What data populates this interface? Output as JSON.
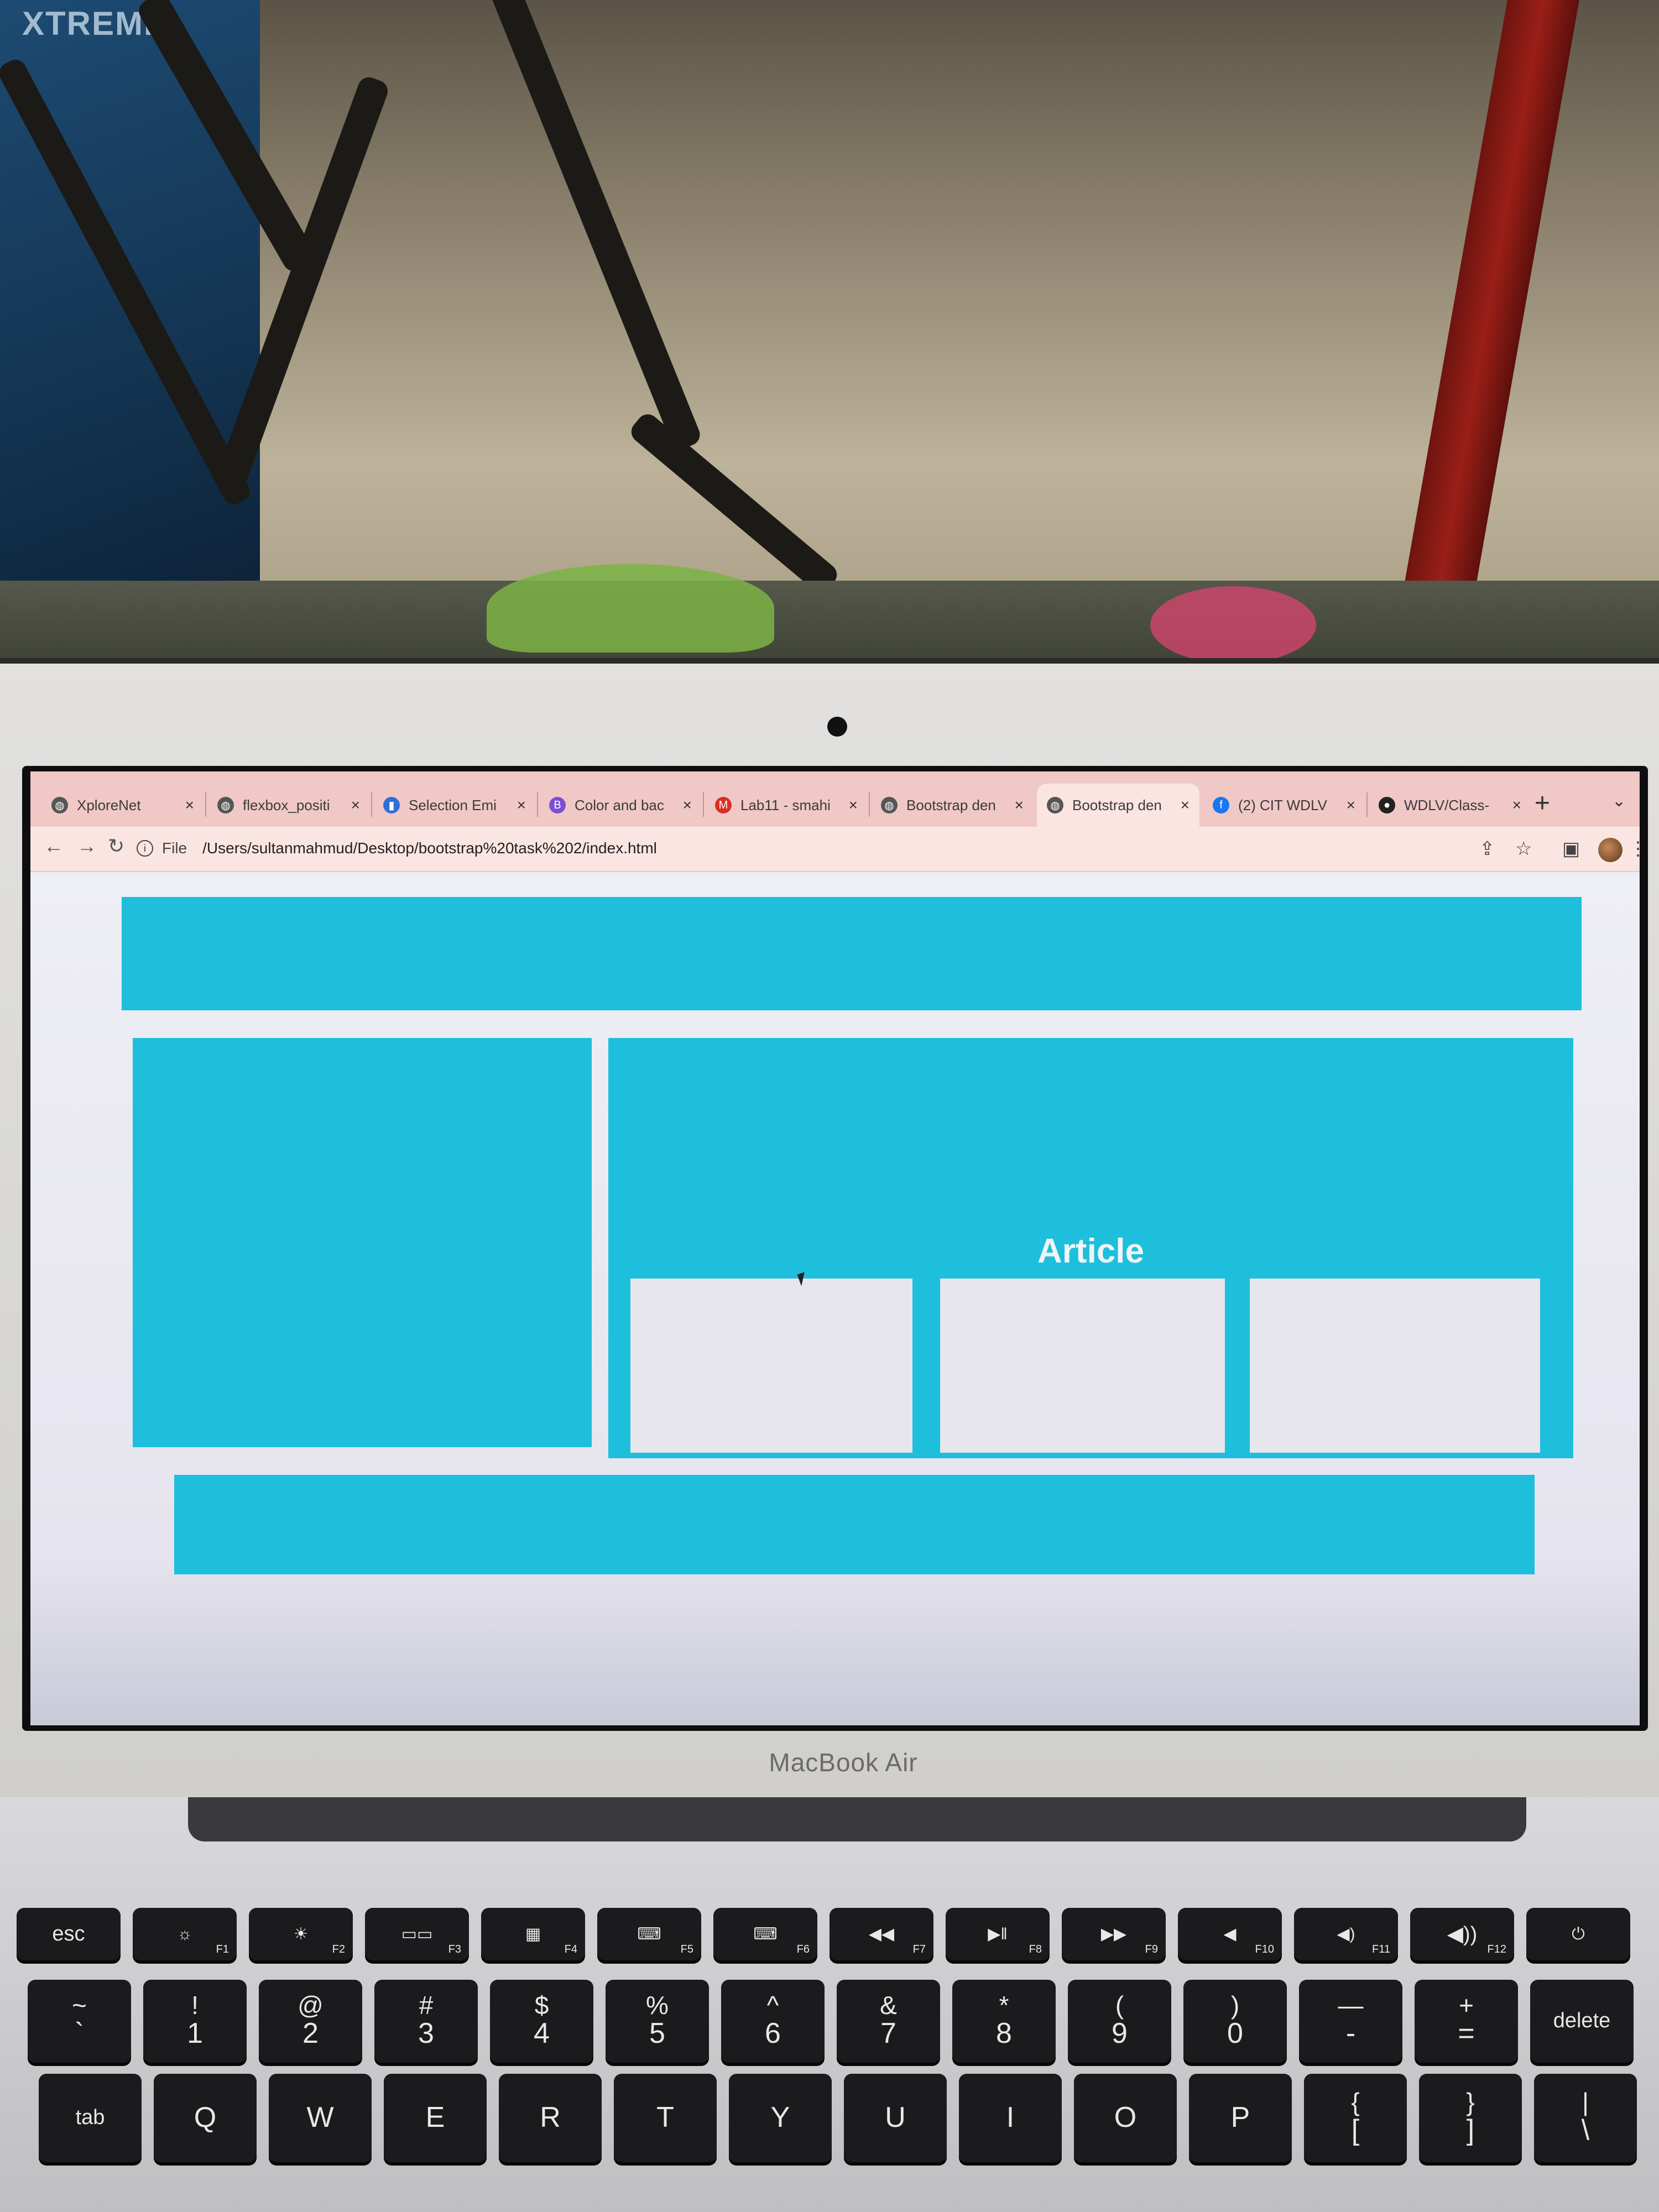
{
  "photo": {
    "poster_text": "XTREME",
    "laptop_label": "MacBook Air"
  },
  "browser": {
    "tabs": [
      {
        "title": "XploreNet",
        "icon": "globe-icon",
        "glyph": "◍",
        "icon_color": "#555555"
      },
      {
        "title": "flexbox_positi",
        "icon": "globe-icon",
        "glyph": "◍",
        "icon_color": "#555555"
      },
      {
        "title": "Selection Emi",
        "icon": "selection-emi-icon",
        "glyph": "▮",
        "icon_color": "#2f6fd6"
      },
      {
        "title": "Color and bac",
        "icon": "bootstrap-icon",
        "glyph": "B",
        "icon_color": "#7b4fd6"
      },
      {
        "title": "Lab11 - smahi",
        "icon": "gmail-icon",
        "glyph": "M",
        "icon_color": "#d93025"
      },
      {
        "title": "Bootstrap den",
        "icon": "globe-icon",
        "glyph": "◍",
        "icon_color": "#555555"
      },
      {
        "title": "Bootstrap den",
        "icon": "globe-icon",
        "glyph": "◍",
        "icon_color": "#555555",
        "active": true
      },
      {
        "title": "(2) CIT WDLV",
        "icon": "facebook-icon",
        "glyph": "f",
        "icon_color": "#1877f2"
      },
      {
        "title": "WDLV/Class-",
        "icon": "github-icon",
        "glyph": "●",
        "icon_color": "#222222"
      }
    ],
    "close_glyph": "×",
    "new_tab_glyph": "+",
    "tab_menu_glyph": "⌄",
    "address": {
      "scheme": "File",
      "url": "/Users/sultanmahmud/Desktop/bootstrap%20task%202/index.html"
    }
  },
  "page": {
    "accent_color": "#1dbfdc",
    "article_title": "Article"
  },
  "keyboard": {
    "fn_row": [
      {
        "main": "esc",
        "fn": ""
      },
      {
        "main": "☼",
        "fn": "F1"
      },
      {
        "main": "☀",
        "fn": "F2"
      },
      {
        "main": "▭▭",
        "fn": "F3"
      },
      {
        "main": "▦",
        "fn": "F4"
      },
      {
        "main": "⌨",
        "fn": "F5"
      },
      {
        "main": "⌨",
        "fn": "F6"
      },
      {
        "main": "◀◀",
        "fn": "F7"
      },
      {
        "main": "▶‖",
        "fn": "F8"
      },
      {
        "main": "▶▶",
        "fn": "F9"
      },
      {
        "main": "◀",
        "fn": "F10"
      },
      {
        "main": "◀)",
        "fn": "F11"
      },
      {
        "main": "◀))",
        "fn": "F12"
      },
      {
        "main": "⏻",
        "fn": ""
      }
    ],
    "num_row": [
      {
        "shift": "~",
        "main": "`"
      },
      {
        "shift": "!",
        "main": "1"
      },
      {
        "shift": "@",
        "main": "2"
      },
      {
        "shift": "#",
        "main": "3"
      },
      {
        "shift": "$",
        "main": "4"
      },
      {
        "shift": "%",
        "main": "5"
      },
      {
        "shift": "^",
        "main": "6"
      },
      {
        "shift": "&",
        "main": "7"
      },
      {
        "shift": "*",
        "main": "8"
      },
      {
        "shift": "(",
        "main": "9"
      },
      {
        "shift": ")",
        "main": "0"
      },
      {
        "shift": "—",
        "main": "-"
      },
      {
        "shift": "+",
        "main": "="
      },
      {
        "shift": "",
        "main": "delete"
      }
    ],
    "letter_row": [
      {
        "shift": "",
        "main": "tab"
      },
      {
        "shift": "",
        "main": "Q"
      },
      {
        "shift": "",
        "main": "W"
      },
      {
        "shift": "",
        "main": "E"
      },
      {
        "shift": "",
        "main": "R"
      },
      {
        "shift": "",
        "main": "T"
      },
      {
        "shift": "",
        "main": "Y"
      },
      {
        "shift": "",
        "main": "U"
      },
      {
        "shift": "",
        "main": "I"
      },
      {
        "shift": "",
        "main": "O"
      },
      {
        "shift": "",
        "main": "P"
      },
      {
        "shift": "{",
        "main": "["
      },
      {
        "shift": "}",
        "main": "]"
      },
      {
        "shift": "|",
        "main": "\\"
      }
    ]
  }
}
